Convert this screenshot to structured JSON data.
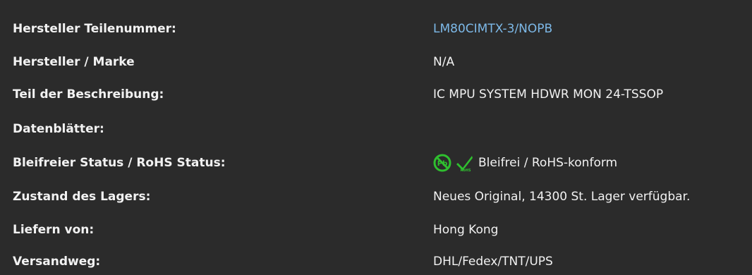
{
  "specs": [
    {
      "label": "Hersteller Teilenummer:",
      "value": "LM80CIMTX-3/NOPB",
      "link": true
    },
    {
      "label": "Hersteller / Marke",
      "value": "N/A"
    },
    {
      "label": "Teil der Beschreibung:",
      "value": "IC MPU SYSTEM HDWR MON 24-TSSOP"
    },
    {
      "label": "Datenblätter:",
      "value": ""
    },
    {
      "label": "Bleifreier Status / RoHS Status:",
      "value": "Bleifrei / RoHS-konform",
      "icons": [
        "lead-free-icon",
        "rohs-check-icon"
      ],
      "icon_badge_text": "RoHS"
    },
    {
      "label": "Zustand des Lagers:",
      "value": "Neues Original, 14300 St. Lager verfügbar."
    },
    {
      "label": "Liefern von:",
      "value": "Hong Kong"
    },
    {
      "label": "Versandweg:",
      "value": "DHL/Fedex/TNT/UPS"
    }
  ],
  "colors": {
    "background": "#2b2b2b",
    "text": "#f2f2f2",
    "link": "#7db9e8",
    "icon_green": "#2fbf2f"
  }
}
